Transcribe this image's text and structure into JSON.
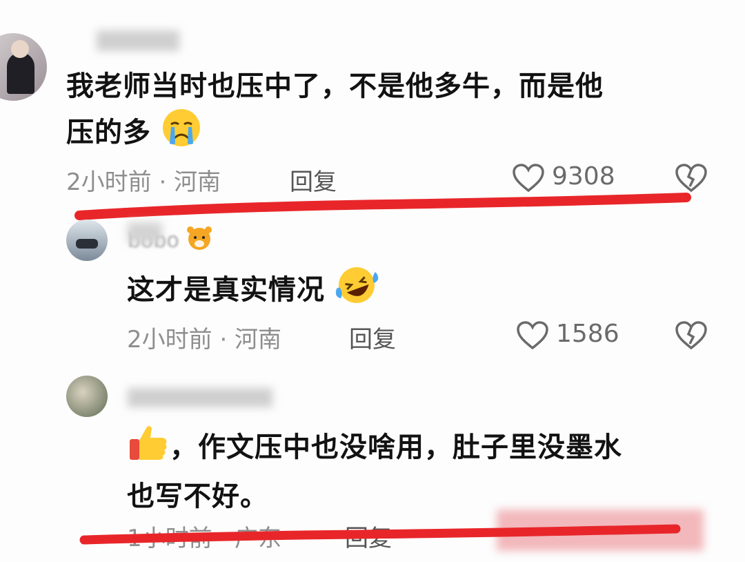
{
  "comments": [
    {
      "text_line1": "我老师当时也压中了，不是他多牛，而是他",
      "text_line2": "压的多",
      "time_location": "2小时前 · 河南",
      "reply_label": "回复",
      "like_count": "9308",
      "emoji": "crying-face"
    },
    {
      "username_partial": "bobo",
      "text_line1": "这才是真实情况",
      "time_location": "2小时前 · 河南",
      "reply_label": "回复",
      "like_count": "1586",
      "emoji": "rolling-on-floor-laughing"
    },
    {
      "text_line1": "，作文压中也没啥用，肚子里没墨水",
      "text_line2": "也写不好。",
      "time_location": "1小时前 · 广东",
      "reply_label": "回复",
      "emoji": "thumbs-up"
    }
  ],
  "colors": {
    "annotation_red": "#e8262a",
    "meta_gray": "#8e8e8e",
    "icon_gray": "#6a6a6a"
  }
}
